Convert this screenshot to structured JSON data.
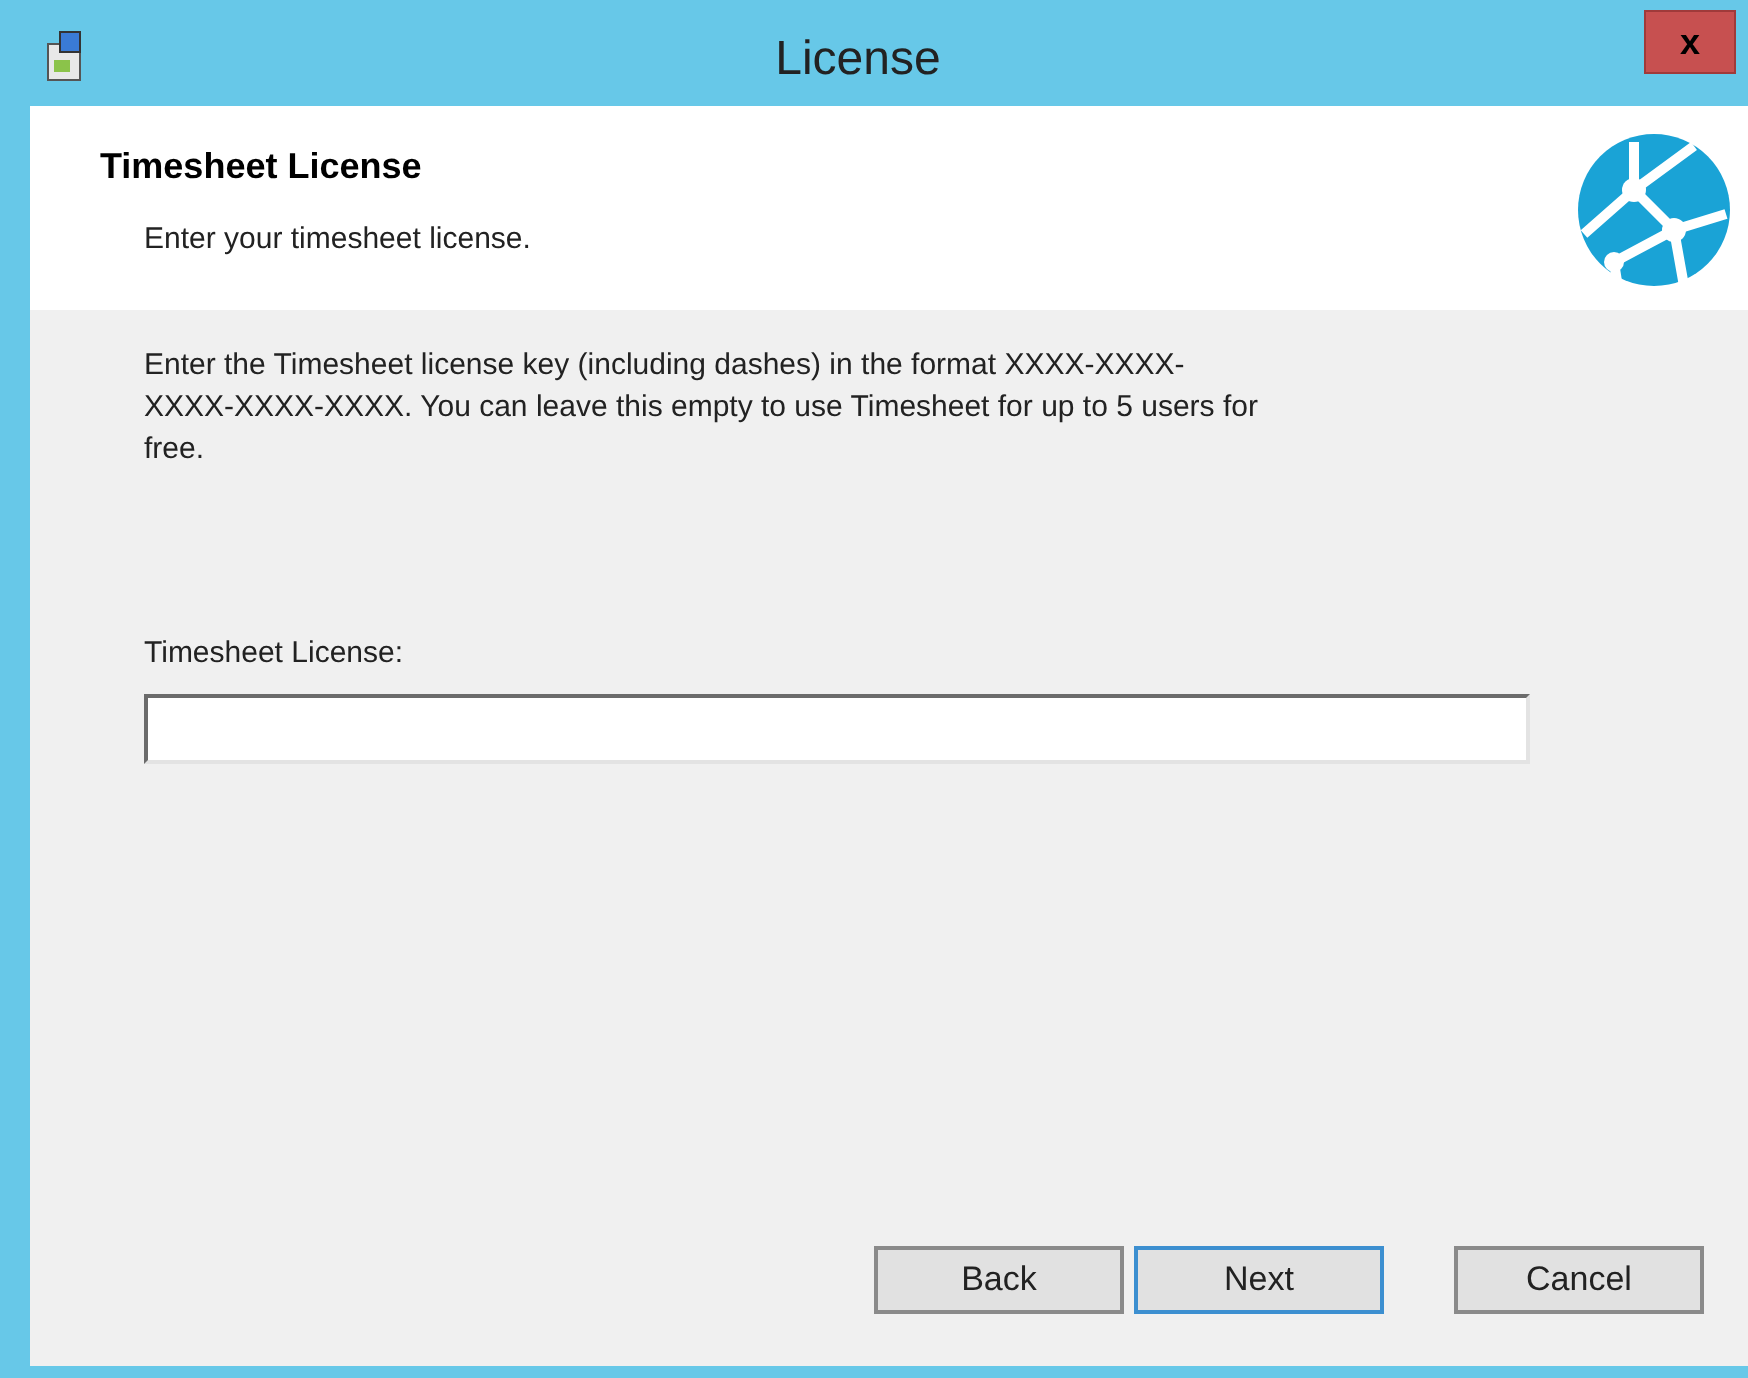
{
  "window": {
    "title": "License",
    "close_label": "x"
  },
  "header": {
    "title": "Timesheet License",
    "subtitle": "Enter your timesheet license."
  },
  "description": "Enter the Timesheet license key (including dashes) in the format XXXX-XXXX-XXXX-XXXX-XXXX. You can leave this empty to use Timesheet for up to 5 users for free.",
  "field": {
    "label": "Timesheet License:",
    "focused": true
  },
  "buttons": [
    {
      "label": "Back",
      "focused": false
    },
    {
      "label": "Next",
      "focused": true
    },
    {
      "label": "Cancel",
      "focused": false
    }
  ]
}
